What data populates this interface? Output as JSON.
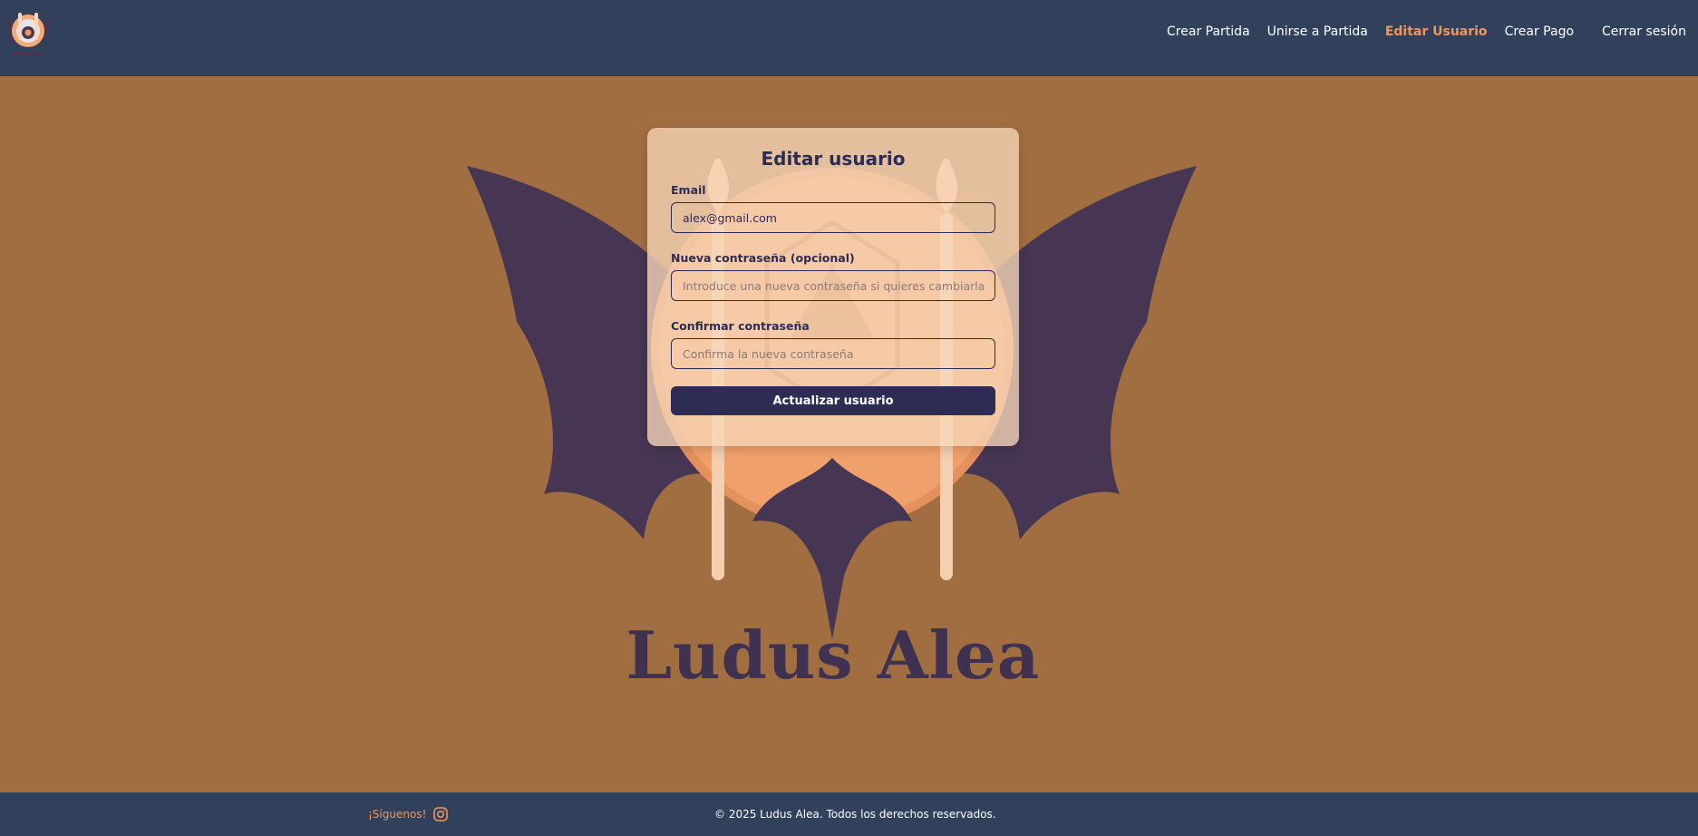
{
  "nav": {
    "crear_partida": "Crear Partida",
    "unirse_partida": "Unirse a Partida",
    "editar_usuario": "Editar Usuario",
    "crear_pago": "Crear Pago",
    "cerrar_sesion": "Cerrar sesión",
    "active_item": "editar_usuario"
  },
  "brand": {
    "name": "Ludus Alea",
    "logo_icon": "bat-dice-logo-icon"
  },
  "form": {
    "title": "Editar usuario",
    "email_label": "Email",
    "email_value": "alex@gmail.com",
    "password_label": "Nueva contraseña (opcional)",
    "password_placeholder": "Introduce una nueva contraseña si quieres cambiarla",
    "confirm_label": "Confirmar contraseña",
    "confirm_placeholder": "Confirma la nueva contraseña",
    "submit_label": "Actualizar usuario"
  },
  "footer": {
    "follow_text": "¡Síguenos!",
    "follow_icon": "instagram-icon",
    "copyright": "© 2025 Ludus Alea. Todos los derechos reservados."
  },
  "colors": {
    "header_bg": "#31405b",
    "page_bg": "#a16e41",
    "accent": "#f0955f",
    "primary": "#2c2c55",
    "logo_purple": "#463653"
  }
}
